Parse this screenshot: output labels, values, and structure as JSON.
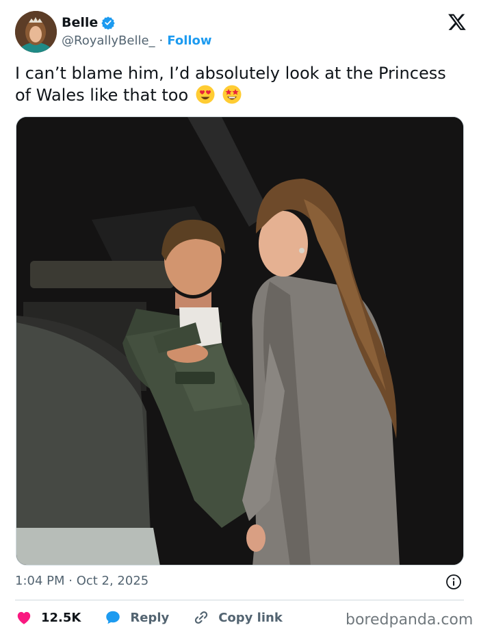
{
  "post": {
    "display_name": "Belle",
    "handle": "@RoyallyBelle_",
    "separator": "·",
    "follow_label": "Follow",
    "text": "I can’t blame him, I’d absolutely look at the Princess of Wales like that too",
    "timestamp": "1:04 PM · Oct 2, 2025"
  },
  "actions": {
    "like_count": "12.5K",
    "reply_label": "Reply",
    "copy_link_label": "Copy link"
  },
  "watermark": "boredpanda.com",
  "icons": [
    "verified-badge-icon",
    "x-logo-icon",
    "heart-eyes-emoji",
    "star-struck-emoji",
    "info-icon",
    "heart-icon",
    "reply-bubble-icon",
    "link-icon"
  ],
  "colors": {
    "accent": "#1d9bf0",
    "like": "#f91880",
    "text": "#0f1419",
    "muted": "#536471"
  }
}
